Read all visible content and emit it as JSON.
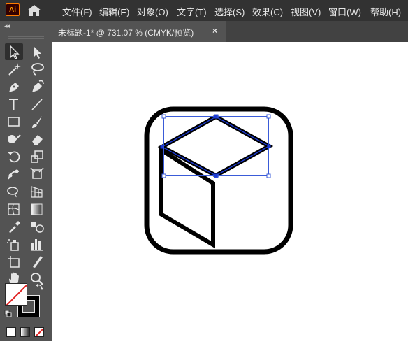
{
  "app": {
    "logo_text": "Ai"
  },
  "menu": {
    "items": [
      {
        "label": "文件(F)"
      },
      {
        "label": "编辑(E)"
      },
      {
        "label": "对象(O)"
      },
      {
        "label": "文字(T)"
      },
      {
        "label": "选择(S)"
      },
      {
        "label": "效果(C)"
      },
      {
        "label": "视图(V)"
      },
      {
        "label": "窗口(W)"
      },
      {
        "label": "帮助(H)"
      }
    ]
  },
  "document_tab": {
    "title": "未标题-1* @ 731.07 % (CMYK/预览)",
    "close_glyph": "×"
  },
  "toolbar": {
    "collapse_glyph": "◂◂",
    "tools": [
      {
        "name": "selection-tool",
        "icon": "selection-arrow-icon"
      },
      {
        "name": "direct-selection-tool",
        "icon": "direct-selection-arrow-icon"
      },
      {
        "name": "magic-wand-tool",
        "icon": "magic-wand-icon"
      },
      {
        "name": "lasso-tool",
        "icon": "lasso-icon"
      },
      {
        "name": "pen-tool",
        "icon": "pen-icon"
      },
      {
        "name": "curvature-tool",
        "icon": "curvature-pen-icon"
      },
      {
        "name": "type-tool",
        "icon": "type-icon"
      },
      {
        "name": "line-segment-tool",
        "icon": "line-segment-icon"
      },
      {
        "name": "rectangle-tool",
        "icon": "rectangle-icon"
      },
      {
        "name": "paintbrush-tool",
        "icon": "paintbrush-icon"
      },
      {
        "name": "shaper-tool",
        "icon": "shaper-icon"
      },
      {
        "name": "eraser-tool",
        "icon": "eraser-icon"
      },
      {
        "name": "rotate-tool",
        "icon": "rotate-icon"
      },
      {
        "name": "scale-tool",
        "icon": "scale-icon"
      },
      {
        "name": "puppet-warp-tool",
        "icon": "puppet-warp-icon"
      },
      {
        "name": "free-transform-tool",
        "icon": "free-transform-icon"
      },
      {
        "name": "shape-builder-tool",
        "icon": "shape-builder-icon"
      },
      {
        "name": "perspective-grid-tool",
        "icon": "perspective-grid-icon"
      },
      {
        "name": "mesh-tool",
        "icon": "mesh-icon"
      },
      {
        "name": "gradient-tool",
        "icon": "gradient-icon"
      },
      {
        "name": "eyedropper-tool",
        "icon": "eyedropper-icon"
      },
      {
        "name": "blend-tool",
        "icon": "blend-icon"
      },
      {
        "name": "symbol-sprayer-tool",
        "icon": "symbol-sprayer-icon"
      },
      {
        "name": "column-graph-tool",
        "icon": "column-graph-icon"
      },
      {
        "name": "artboard-tool",
        "icon": "artboard-icon"
      },
      {
        "name": "slice-tool",
        "icon": "slice-icon"
      },
      {
        "name": "hand-tool",
        "icon": "hand-icon"
      },
      {
        "name": "zoom-tool",
        "icon": "zoom-icon"
      }
    ],
    "fill_color": "#ffffff",
    "stroke_color": "#000000",
    "none_color": "#e02020"
  },
  "colors": {
    "menubar_bg": "#323232",
    "toolbar_bg": "#535353",
    "selection_blue": "#1c3bd6",
    "logo_orange": "#ff9a00"
  }
}
